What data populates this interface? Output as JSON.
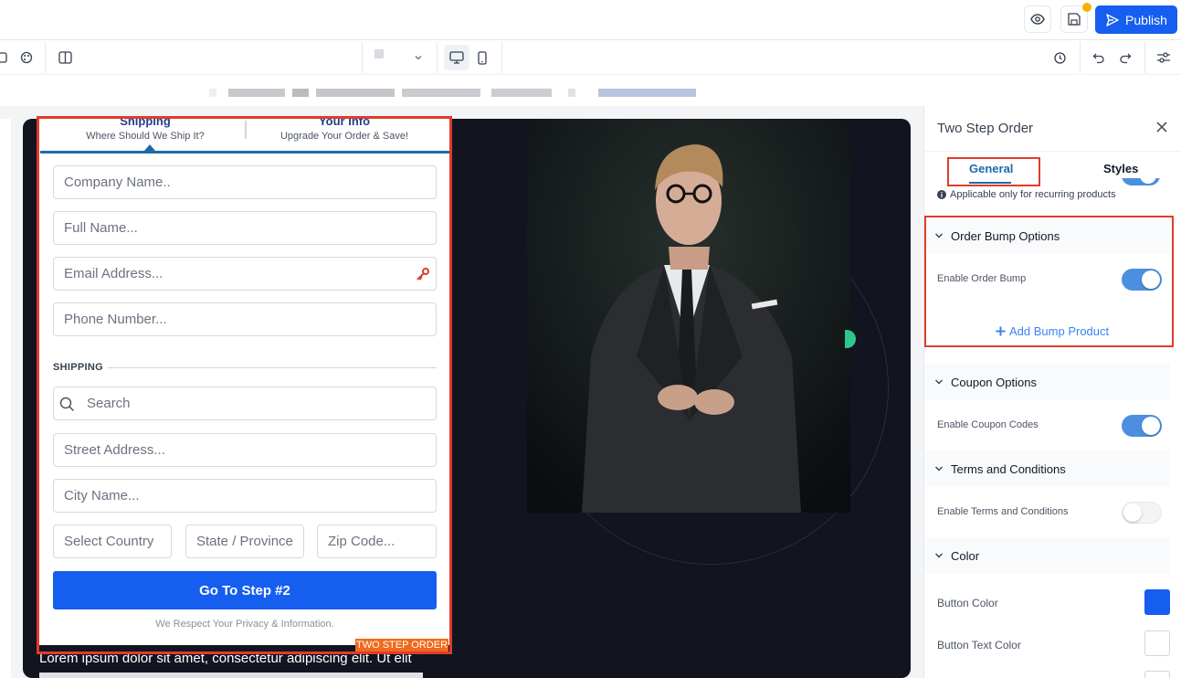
{
  "header": {
    "publish_label": "Publish"
  },
  "form": {
    "tabs": [
      {
        "title": "Shipping",
        "subtitle": "Where Should We Ship It?"
      },
      {
        "title": "Your Info",
        "subtitle": "Upgrade Your Order & Save!"
      }
    ],
    "placeholders": {
      "company": "Company Name..",
      "full_name": "Full Name...",
      "email": "Email Address...",
      "phone": "Phone Number...",
      "search": "Search",
      "street": "Street Address...",
      "city": "City Name...",
      "country": "Select Country",
      "state": "State / Province",
      "zip": "Zip Code..."
    },
    "shipping_label": "SHIPPING",
    "submit_label": "Go To Step #2",
    "privacy_text": "We Respect Your Privacy & Information.",
    "badge": "TWO STEP ORDER"
  },
  "canvas": {
    "lorem": "Lorem ipsum dolor sit amet, consectetur adipiscing elit. Ut elit"
  },
  "panel": {
    "title": "Two Step Order",
    "tabs": {
      "general": "General",
      "styles": "Styles"
    },
    "recurring_note": "Applicable only for recurring products",
    "order_bump": {
      "heading": "Order Bump Options",
      "enable_label": "Enable Order Bump",
      "enabled": true,
      "add_label": "Add Bump Product"
    },
    "coupon": {
      "heading": "Coupon Options",
      "enable_label": "Enable Coupon Codes",
      "enabled": true
    },
    "terms": {
      "heading": "Terms and Conditions",
      "enable_label": "Enable Terms and Conditions",
      "enabled": false
    },
    "color": {
      "heading": "Color",
      "button_color_label": "Button Color",
      "button_color": "#155eef",
      "button_text_color_label": "Button Text Color",
      "button_text_color": "#ffffff"
    }
  },
  "colors": {
    "accent": "#155eef",
    "highlight": "#e23b2a",
    "badge": "#f06a1c",
    "toggle_on": "#4c8fe0"
  }
}
